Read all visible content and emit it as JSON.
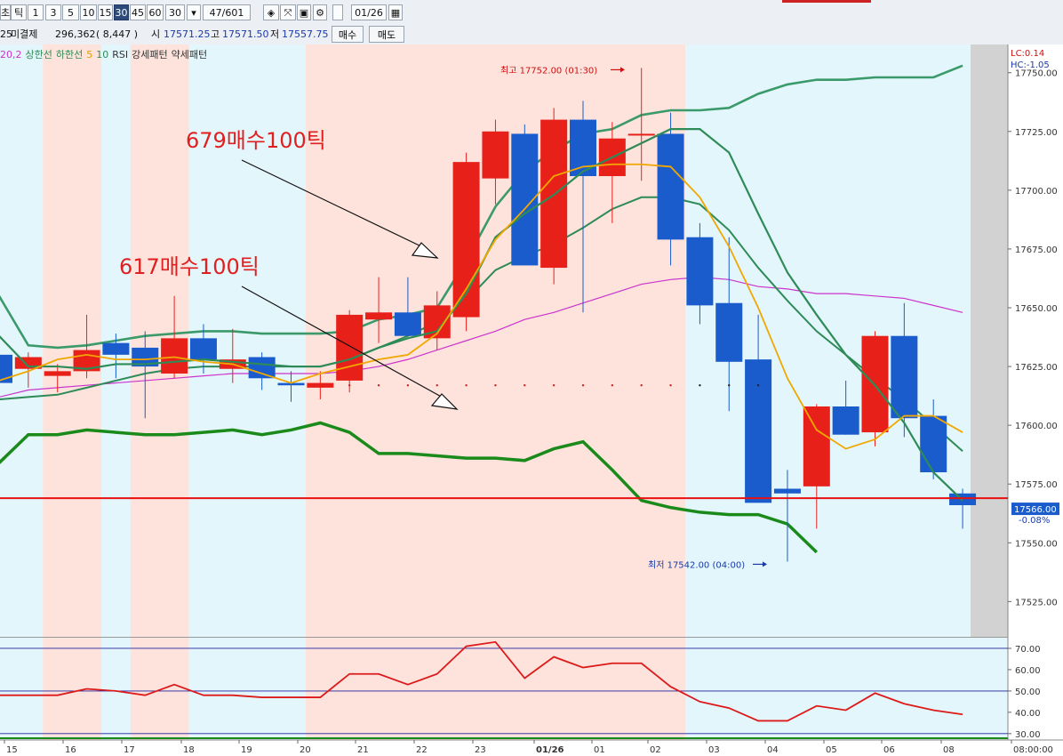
{
  "toolbar": {
    "items": [
      "초",
      "틱",
      "1",
      "3",
      "5",
      "10",
      "15",
      "30",
      "45",
      "60",
      "30",
      "47/601",
      "01/26"
    ],
    "active_index": 7
  },
  "quote": {
    "unresolved_left": "25",
    "label": "미결제",
    "open_interest": "296,362",
    "oi_change": "( 8,447 )",
    "open_label": "시",
    "open": "17571.25",
    "high_label": "고",
    "high": "17571.50",
    "low_label": "저",
    "low": "17557.75",
    "buy_label": "매수",
    "sell_label": "매도"
  },
  "legend": {
    "items": [
      {
        "text": "20,2",
        "color": "#cc33cc"
      },
      {
        "text": "상한선",
        "color": "#2e8b57"
      },
      {
        "text": "하한선",
        "color": "#2e8b57"
      },
      {
        "text": "5",
        "color": "#e0a000"
      },
      {
        "text": "10",
        "color": "#2e8b57"
      },
      {
        "text": "RSI",
        "color": "#333333"
      },
      {
        "text": "강세패턴",
        "color": "#333333"
      },
      {
        "text": "약세패턴",
        "color": "#333333"
      }
    ]
  },
  "annotations": {
    "a1": "679매수100틱",
    "a2": "617매수100틱",
    "high": "최고 17752.00 (01:30)",
    "low": "최저 17542.00 (04:00)"
  },
  "right_info": {
    "lc": "LC:0.14",
    "hc": "HC:-1.05",
    "price": "17566.00",
    "pct": "-0.08%"
  },
  "chart_data": {
    "type": "candlestick",
    "ylim": [
      17510,
      17762
    ],
    "y_ticks": [
      "17525.00",
      "17550.00",
      "17575.00",
      "17600.00",
      "17625.00",
      "17650.00",
      "17675.00",
      "17700.00",
      "17725.00",
      "17750.00"
    ],
    "x_labels": [
      "15",
      "16",
      "17",
      "18",
      "19",
      "20",
      "21",
      "22",
      "23",
      "01/26",
      "01",
      "02",
      "03",
      "04",
      "05",
      "06",
      "08",
      "08:00:00"
    ],
    "candles": [
      {
        "o": 17630,
        "h": 17634,
        "l": 17613,
        "c": 17618
      },
      {
        "o": 17624,
        "h": 17631,
        "l": 17616,
        "c": 17629
      },
      {
        "o": 17621,
        "h": 17626,
        "l": 17614,
        "c": 17623
      },
      {
        "o": 17623,
        "h": 17647,
        "l": 17620,
        "c": 17632
      },
      {
        "o": 17635,
        "h": 17639,
        "l": 17620,
        "c": 17630
      },
      {
        "o": 17633,
        "h": 17640,
        "l": 17603,
        "c": 17625
      },
      {
        "o": 17622,
        "h": 17655,
        "l": 17620,
        "c": 17637
      },
      {
        "o": 17637,
        "h": 17643,
        "l": 17622,
        "c": 17628
      },
      {
        "o": 17624,
        "h": 17641,
        "l": 17618,
        "c": 17628
      },
      {
        "o": 17629,
        "h": 17631,
        "l": 17615,
        "c": 17620
      },
      {
        "o": 17618,
        "h": 17623,
        "l": 17610,
        "c": 17617
      },
      {
        "o": 17616,
        "h": 17623,
        "l": 17611,
        "c": 17618
      },
      {
        "o": 17619,
        "h": 17649,
        "l": 17614,
        "c": 17647
      },
      {
        "o": 17645,
        "h": 17663,
        "l": 17635,
        "c": 17648
      },
      {
        "o": 17648,
        "h": 17663,
        "l": 17638,
        "c": 17638
      },
      {
        "o": 17637,
        "h": 17657,
        "l": 17632,
        "c": 17651
      },
      {
        "o": 17646,
        "h": 17716,
        "l": 17640,
        "c": 17712
      },
      {
        "o": 17705,
        "h": 17730,
        "l": 17694,
        "c": 17725
      },
      {
        "o": 17724,
        "h": 17728,
        "l": 17670,
        "c": 17668
      },
      {
        "o": 17667,
        "h": 17735,
        "l": 17660,
        "c": 17730
      },
      {
        "o": 17730,
        "h": 17738,
        "l": 17648,
        "c": 17706
      },
      {
        "o": 17706,
        "h": 17729,
        "l": 17686,
        "c": 17722
      },
      {
        "o": 17724,
        "h": 17752,
        "l": 17704,
        "c": 17724
      },
      {
        "o": 17724,
        "h": 17733,
        "l": 17668,
        "c": 17679
      },
      {
        "o": 17680,
        "h": 17686,
        "l": 17643,
        "c": 17651
      },
      {
        "o": 17652,
        "h": 17680,
        "l": 17606,
        "c": 17627
      },
      {
        "o": 17628,
        "h": 17647,
        "l": 17573,
        "c": 17567
      },
      {
        "o": 17573,
        "h": 17581,
        "l": 17542,
        "c": 17571
      },
      {
        "o": 17574,
        "h": 17609,
        "l": 17556,
        "c": 17608
      },
      {
        "o": 17608,
        "h": 17619,
        "l": 17596,
        "c": 17596
      },
      {
        "o": 17597,
        "h": 17640,
        "l": 17591,
        "c": 17638
      },
      {
        "o": 17638,
        "h": 17652,
        "l": 17595,
        "c": 17603
      },
      {
        "o": 17604,
        "h": 17611,
        "l": 17577,
        "c": 17580
      },
      {
        "o": 17571,
        "h": 17573,
        "l": 17556,
        "c": 17566
      }
    ],
    "upper_band": [
      17655,
      17634,
      17633,
      17634,
      17636,
      17638,
      17639,
      17640,
      17640,
      17639,
      17639,
      17639,
      17640,
      17645,
      17647,
      17650,
      17670,
      17693,
      17708,
      17717,
      17724,
      17726,
      17732,
      17734,
      17734,
      17735,
      17741,
      17745,
      17747,
      17747,
      17748,
      17748,
      17748,
      17753
    ],
    "ma10": [
      17638,
      17625,
      17625,
      17624,
      17626,
      17626,
      17627,
      17628,
      17627,
      17626,
      17625,
      17625,
      17628,
      17633,
      17637,
      17640,
      17656,
      17680,
      17690,
      17698,
      17708,
      17714,
      17720,
      17726,
      17726,
      17716,
      17690,
      17665,
      17647,
      17630,
      17617,
      17601,
      17580,
      17568
    ],
    "ma5": [
      17619,
      17623,
      17628,
      17630,
      17628,
      17628,
      17629,
      17627,
      17626,
      17622,
      17618,
      17622,
      17625,
      17628,
      17630,
      17639,
      17658,
      17679,
      17692,
      17706,
      17710,
      17711,
      17711,
      17710,
      17697,
      17676,
      17650,
      17620,
      17598,
      17590,
      17594,
      17604,
      17604,
      17597
    ],
    "bb_mid": [
      17612,
      17615,
      17616,
      17617,
      17618,
      17619,
      17620,
      17621,
      17622,
      17622,
      17622,
      17622,
      17623,
      17625,
      17628,
      17632,
      17636,
      17640,
      17645,
      17648,
      17652,
      17656,
      17660,
      17662,
      17663,
      17662,
      17659,
      17658,
      17656,
      17656,
      17655,
      17654,
      17651,
      17648
    ],
    "lower_band": [
      17611,
      17612,
      17613,
      17616,
      17619,
      17622,
      17624,
      17625,
      17625,
      17625,
      17625,
      17625,
      17628,
      17633,
      17638,
      17644,
      17653,
      17666,
      17672,
      17677,
      17684,
      17692,
      17697,
      17697,
      17694,
      17683,
      17667,
      17653,
      17640,
      17630,
      17620,
      17611,
      17600,
      17589
    ],
    "thick_line": [
      17584,
      17596,
      17596,
      17598,
      17597,
      17596,
      17596,
      17597,
      17598,
      17596,
      17598,
      17601,
      17597,
      17588,
      17588,
      17587,
      17586,
      17586,
      17585,
      17590,
      17593,
      17581,
      17568,
      17565,
      17563,
      17562,
      17562,
      17558,
      17546
    ],
    "pattern_dots_y": 17617,
    "current_price": 17569,
    "highlight_bands": [
      [
        2,
        3
      ],
      [
        5,
        6
      ],
      [
        11,
        23
      ]
    ],
    "rsi": {
      "ylim": [
        27,
        75
      ],
      "y_ticks": [
        "30.00",
        "40.00",
        "50.00",
        "60.00",
        "70.00"
      ],
      "values": [
        48,
        48,
        48,
        51,
        50,
        48,
        53,
        48,
        48,
        47,
        47,
        47,
        58,
        58,
        53,
        58,
        71,
        73,
        56,
        66,
        61,
        63,
        63,
        52,
        45,
        42,
        36,
        36,
        43,
        41,
        49,
        44,
        41,
        39
      ]
    }
  }
}
